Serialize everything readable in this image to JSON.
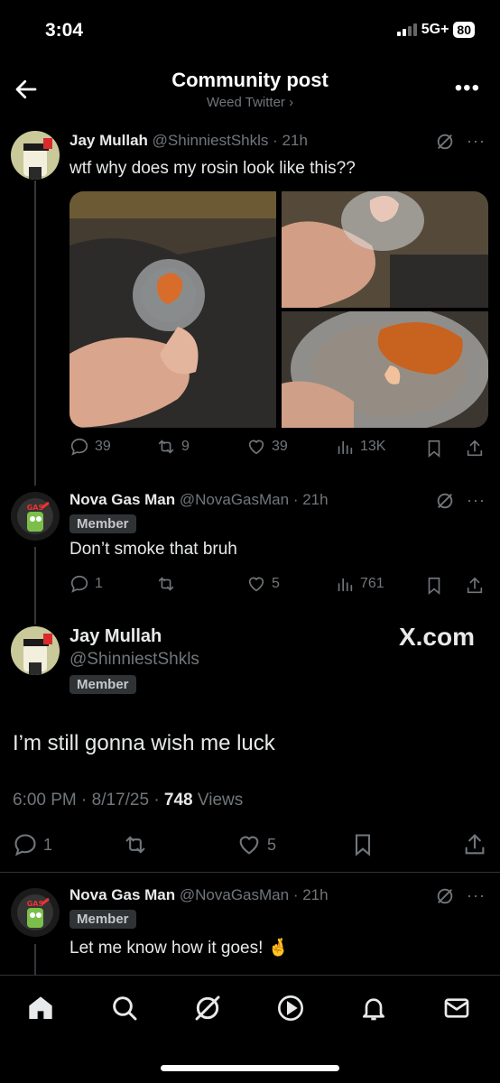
{
  "status": {
    "time": "3:04",
    "network": "5G+",
    "battery": "80"
  },
  "header": {
    "title": "Community post",
    "community": "Weed Twitter",
    "community_chevron": "›"
  },
  "tweets": [
    {
      "name": "Jay Mullah",
      "handle": "@ShinniestShkls",
      "time": "· 21h",
      "text": "wtf why does my rosin look like this??",
      "stats": {
        "replies": "39",
        "reposts": "9",
        "likes": "39",
        "views": "13K"
      }
    },
    {
      "name": "Nova Gas Man",
      "handle": "@NovaGasMan",
      "time": "· 21h",
      "badge": "Member",
      "text": "Don’t smoke that bruh",
      "stats": {
        "replies": "1",
        "reposts": "",
        "likes": "5",
        "views": "761"
      }
    }
  ],
  "focus": {
    "name": "Jay Mullah",
    "handle": "@ShinniestShkls",
    "badge": "Member",
    "watermark": "X.com",
    "text": "I’m still gonna wish me luck",
    "meta_time": "6:00 PM · 8/17/25 · ",
    "meta_views": "748",
    "meta_views_label": " Views",
    "stats": {
      "replies": "1",
      "likes": "5"
    }
  },
  "reply": {
    "name": "Nova Gas Man",
    "handle": "@NovaGasMan",
    "time": "· 21h",
    "badge": "Member",
    "text": "Let me know how it goes! 🤞"
  },
  "nav": [
    "home-icon",
    "search-icon",
    "grok-icon",
    "video-icon",
    "notifications-icon",
    "messages-icon"
  ],
  "colors": {
    "background": "#000000",
    "text": "#e7e9ea",
    "muted": "#71767b",
    "divider": "#2f3336"
  }
}
